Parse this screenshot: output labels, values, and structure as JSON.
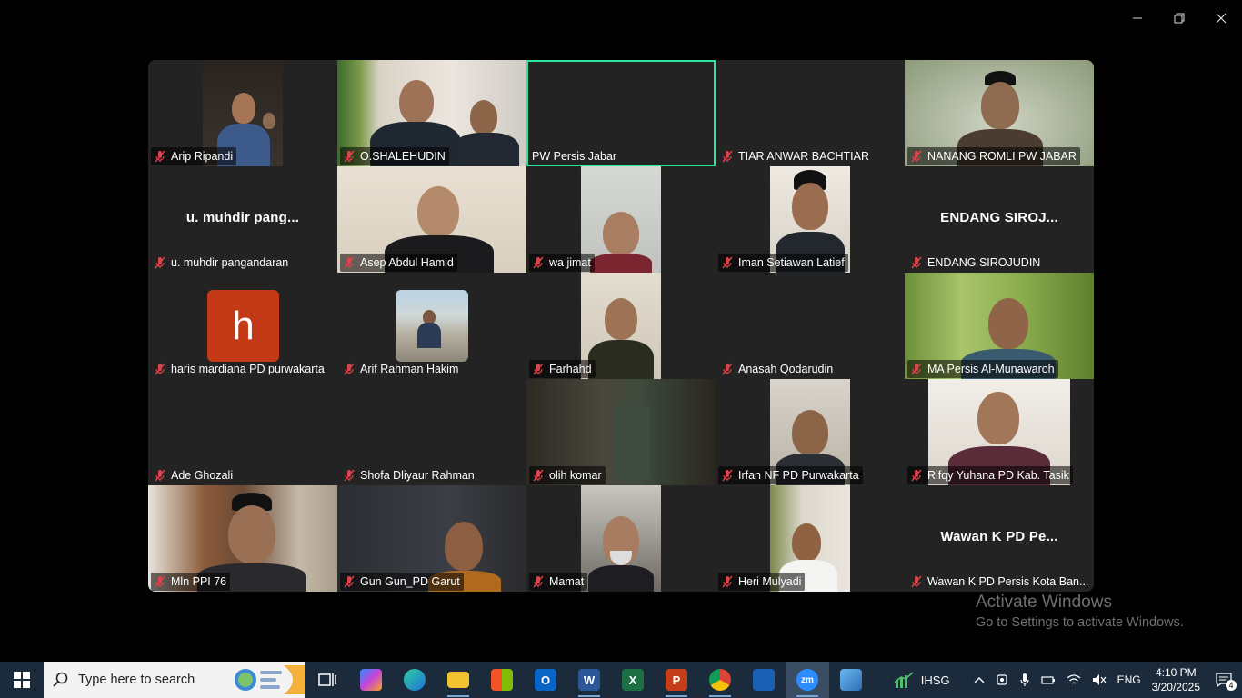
{
  "window": {
    "controls": [
      "minimize-icon",
      "restore-icon",
      "close-icon"
    ]
  },
  "participants": [
    {
      "name": "Arip Ripandi",
      "video": true
    },
    {
      "name": "O.SHALEHUDIN",
      "video": true
    },
    {
      "name": "PW Persis Jabar",
      "video": false,
      "active": true,
      "muted": false
    },
    {
      "name": "TIAR ANWAR BACHTIAR",
      "video": false
    },
    {
      "name": "NANANG ROMLI PW JABAR",
      "video": true
    },
    {
      "name": "u. muhdir pangandaran",
      "display_short": "u. muhdir pang...",
      "video": false
    },
    {
      "name": "Asep Abdul Hamid",
      "video": true
    },
    {
      "name": "wa jimat",
      "video": true
    },
    {
      "name": "Iman Setiawan Latief",
      "video": true
    },
    {
      "name": "ENDANG SIROJUDIN",
      "display_short": "ENDANG SIROJ...",
      "video": false
    },
    {
      "name": "haris mardiana PD purwakarta",
      "avatar_letter": "h",
      "video": false
    },
    {
      "name": "Arif Rahman Hakim",
      "video": false,
      "photo": true
    },
    {
      "name": "Farhahd",
      "video": true
    },
    {
      "name": "Anasah Qodarudin",
      "video": false
    },
    {
      "name": "MA Persis Al-Munawaroh",
      "video": true
    },
    {
      "name": "Ade Ghozali",
      "video": false
    },
    {
      "name": "Shofa Dliyaur Rahman",
      "video": false
    },
    {
      "name": "olih komar",
      "video": true
    },
    {
      "name": "Irfan NF PD Purwakarta",
      "video": true
    },
    {
      "name": "Rifqy Yuhana PD Kab. Tasik",
      "video": true
    },
    {
      "name": "Mln PPI 76",
      "video": true
    },
    {
      "name": "Gun Gun_PD Garut",
      "video": true
    },
    {
      "name": "Mamat",
      "video": true
    },
    {
      "name": "Heri Mulyadi",
      "video": true
    },
    {
      "name": "Wawan K PD Persis Kota Ban...",
      "display_short": "Wawan K PD Pe...",
      "video": false
    }
  ],
  "watermark": {
    "line1": "Activate Windows",
    "line2": "Go to Settings to activate Windows."
  },
  "taskbar": {
    "search_placeholder": "Type here to search",
    "apps": [
      "task-view",
      "copilot",
      "edge",
      "file-explorer",
      "microsoft-store",
      "outlook",
      "word",
      "excel",
      "powerpoint",
      "chrome",
      "remote-desktop",
      "zoom",
      "photos"
    ],
    "stock_label": "IHSG",
    "language": "ENG",
    "time": "4:10 PM",
    "date": "3/20/2025",
    "notification_count": "4"
  },
  "colors": {
    "active_border": "#2ee59d",
    "tile_bg": "#232323",
    "muted_icon": "#e0414b",
    "taskbar_bg": "#1b2b3c"
  }
}
